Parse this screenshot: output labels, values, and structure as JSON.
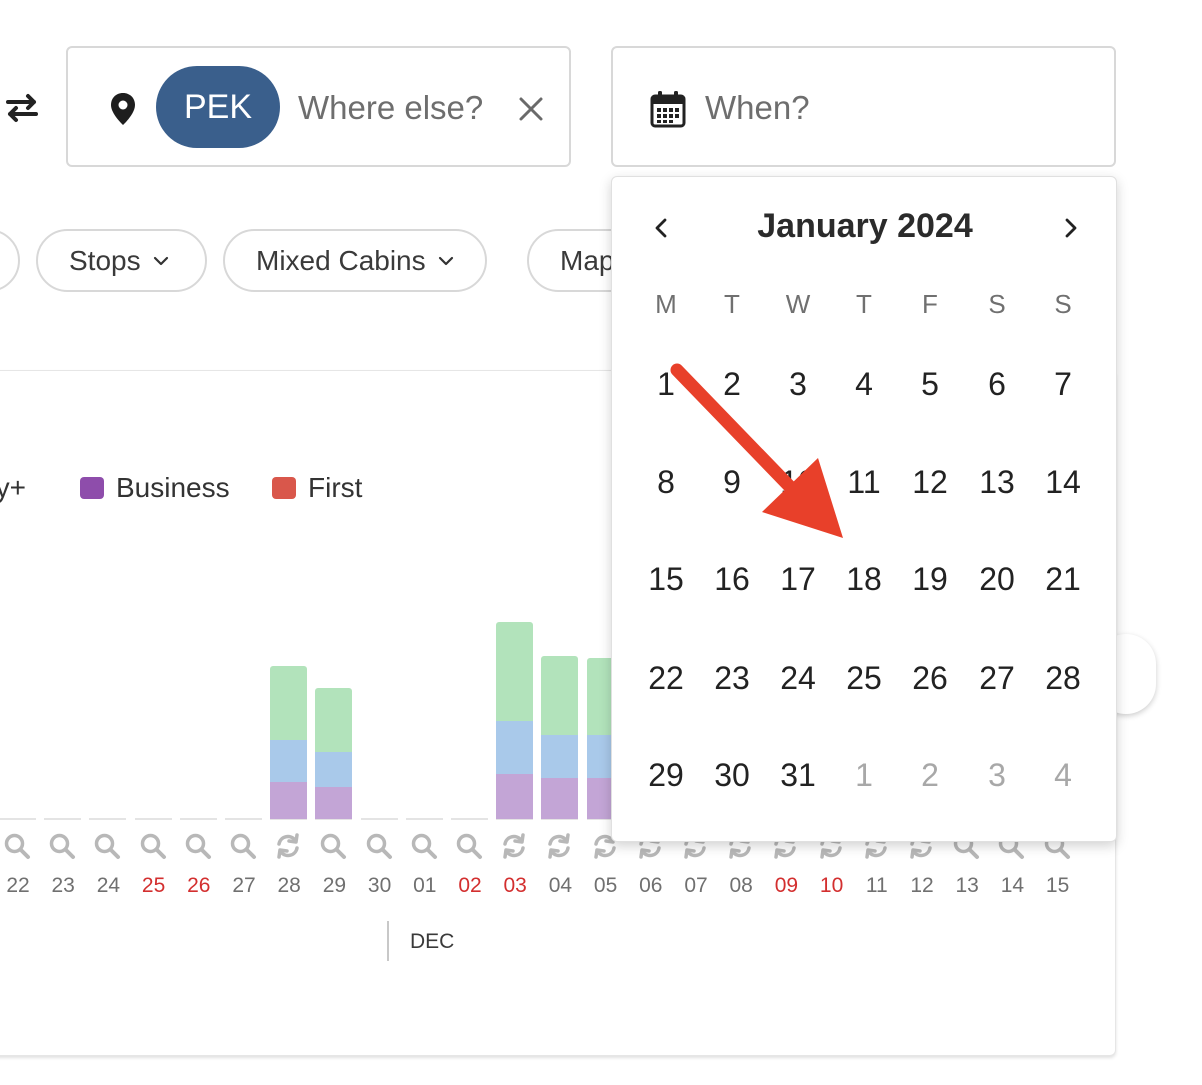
{
  "search": {
    "origin_icon": "swap-arrows-icon",
    "destination_chip": "PEK",
    "destination_placeholder": "Where else?",
    "date_placeholder": "When?"
  },
  "filters": {
    "pills": [
      "Stops",
      "Mixed Cabins",
      "Map"
    ]
  },
  "legend": {
    "items": [
      {
        "label": "ny+",
        "color": "#a9c9ea"
      },
      {
        "label": "Business",
        "color": "#8e4dab"
      },
      {
        "label": "First",
        "color": "#d9574b"
      }
    ]
  },
  "chart_data": {
    "type": "bar",
    "categories": [
      "22",
      "23",
      "24",
      "25",
      "26",
      "27",
      "28",
      "29",
      "30",
      "01",
      "02",
      "03",
      "04",
      "05",
      "06",
      "07",
      "08",
      "09",
      "10",
      "11",
      "12",
      "13",
      "14",
      "15"
    ],
    "weekend_days": [
      "25",
      "26",
      "02",
      "03",
      "09",
      "10"
    ],
    "series": [
      {
        "color": "#c3a5d6",
        "values": [
          0,
          0,
          0,
          0,
          0,
          0,
          37,
          32,
          0,
          0,
          0,
          45,
          41,
          41,
          0,
          0,
          0,
          0,
          0,
          0,
          0,
          0,
          0,
          0
        ]
      },
      {
        "color": "#a9c9ea",
        "values": [
          0,
          0,
          0,
          0,
          0,
          0,
          42,
          35,
          0,
          0,
          0,
          53,
          43,
          43,
          0,
          0,
          0,
          0,
          0,
          0,
          0,
          0,
          0,
          0
        ]
      },
      {
        "color": "#b2e3bb",
        "values": [
          0,
          0,
          0,
          0,
          0,
          0,
          74,
          64,
          0,
          0,
          0,
          99,
          79,
          77,
          0,
          0,
          0,
          0,
          0,
          0,
          0,
          0,
          0,
          0
        ]
      }
    ],
    "day_icons": [
      "search",
      "search",
      "search",
      "search",
      "search",
      "search",
      "refresh",
      "search",
      "search",
      "search",
      "search",
      "refresh",
      "refresh",
      "refresh",
      "refresh",
      "refresh",
      "refresh",
      "refresh",
      "refresh",
      "refresh",
      "refresh",
      "search",
      "search",
      "search"
    ],
    "month_label": "DEC"
  },
  "calendar": {
    "title": "January 2024",
    "weekdays": [
      "M",
      "T",
      "W",
      "T",
      "F",
      "S",
      "S"
    ],
    "days": [
      [
        "1",
        "2",
        "3",
        "4",
        "5",
        "6",
        "7"
      ],
      [
        "8",
        "9",
        "10",
        "11",
        "12",
        "13",
        "14"
      ],
      [
        "15",
        "16",
        "17",
        "18",
        "19",
        "20",
        "21"
      ],
      [
        "22",
        "23",
        "24",
        "25",
        "26",
        "27",
        "28"
      ],
      [
        "29",
        "30",
        "31",
        "1",
        "2",
        "3",
        "4"
      ]
    ],
    "next_month_days": [
      "1",
      "2",
      "3",
      "4"
    ]
  },
  "annotation": {
    "arrow_color": "#e8402a"
  }
}
